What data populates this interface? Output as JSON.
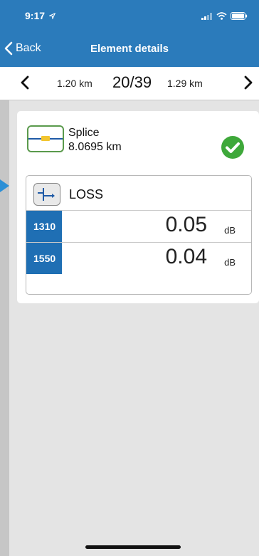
{
  "status_bar": {
    "time": "9:17"
  },
  "nav": {
    "back_label": "Back",
    "title": "Element details"
  },
  "pager": {
    "left_distance": "1.20 km",
    "counter": "20/39",
    "right_distance": "1.29 km"
  },
  "element": {
    "type": "Splice",
    "distance": "8.0695 km",
    "status_color": "#3ea83a"
  },
  "loss": {
    "label": "LOSS",
    "rows": [
      {
        "wavelength": "1310",
        "value": "0.05",
        "unit": "dB"
      },
      {
        "wavelength": "1550",
        "value": "0.04",
        "unit": "dB"
      }
    ]
  },
  "colors": {
    "accent": "#2b7bbb",
    "wavelength_bg": "#1f6fb4",
    "splice_marker": "#f2c52f",
    "icon_border": "#5a9a4c"
  }
}
